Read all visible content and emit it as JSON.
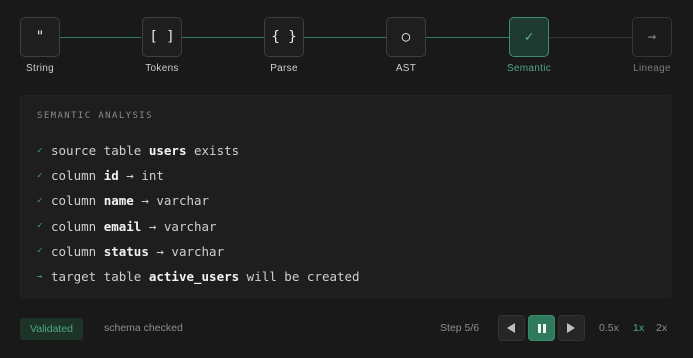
{
  "pipeline": {
    "steps": [
      {
        "glyph": "\"",
        "label": "String",
        "state": "done"
      },
      {
        "glyph": "[ ]",
        "label": "Tokens",
        "state": "done"
      },
      {
        "glyph": "{ }",
        "label": "Parse",
        "state": "done"
      },
      {
        "glyph": "○",
        "label": "AST",
        "state": "done"
      },
      {
        "glyph": "✓",
        "label": "Semantic",
        "state": "active"
      },
      {
        "glyph": "→",
        "label": "Lineage",
        "state": "pending"
      }
    ]
  },
  "panel": {
    "title": "SEMANTIC ANALYSIS",
    "items": [
      {
        "mark": "✓",
        "pre": "source table ",
        "strong": "users",
        "post": " exists"
      },
      {
        "mark": "✓",
        "pre": "column ",
        "strong": "id",
        "post": " → int"
      },
      {
        "mark": "✓",
        "pre": "column ",
        "strong": "name",
        "post": " → varchar"
      },
      {
        "mark": "✓",
        "pre": "column ",
        "strong": "email",
        "post": " → varchar"
      },
      {
        "mark": "✓",
        "pre": "column ",
        "strong": "status",
        "post": " → varchar"
      },
      {
        "mark": "→",
        "pre": "target table ",
        "strong": "active_users",
        "post": " will be created"
      }
    ]
  },
  "footer": {
    "badge": "Validated",
    "status": "schema checked",
    "step_counter": "Step 5/6",
    "speeds": [
      "0.5x",
      "1x",
      "2x"
    ],
    "active_speed": "1x"
  },
  "colors": {
    "accent": "#4ea784",
    "accent_dark": "#2f7a5c",
    "background": "#191919",
    "panel": "#1e1e1e"
  },
  "icons": {
    "prev": "step-back-icon",
    "play": "pause-icon",
    "next": "step-forward-icon"
  }
}
